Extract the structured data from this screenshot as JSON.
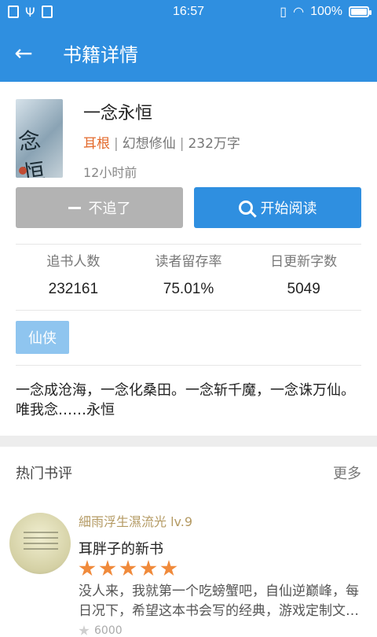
{
  "status_bar": {
    "time": "16:57",
    "battery": "100%"
  },
  "app_bar": {
    "title": "书籍详情"
  },
  "book": {
    "title": "一念永恒",
    "author": "耳根",
    "category": "幻想修仙",
    "word_count": "232万字",
    "updated": "12小时前",
    "cover_text": "一念永恒"
  },
  "actions": {
    "unfollow_label": "不追了",
    "read_label": "开始阅读"
  },
  "stats": [
    {
      "label": "追书人数",
      "value": "232161"
    },
    {
      "label": "读者留存率",
      "value": "75.01%"
    },
    {
      "label": "日更新字数",
      "value": "5049"
    }
  ],
  "tag": "仙侠",
  "description": "一念成沧海，一念化桑田。一念斩千魔，一念诛万仙。唯我念……永恒",
  "reviews": {
    "header": "热门书评",
    "more": "更多",
    "items": [
      {
        "user": "細雨浮生濕流光 lv.9",
        "title": "耳胖子的新书",
        "stars": 5,
        "body": "没人来，我就第一个吃螃蟹吧，自仙逆巅峰，每日况下，希望这本书会写的经典，游戏定制文…",
        "likes": "6000"
      }
    ]
  },
  "colors": {
    "primary": "#2f8fe0",
    "author": "#e36a2c",
    "tag_bg": "#8fc5ef",
    "star": "#f08a3b",
    "user_name": "#b49a63"
  }
}
